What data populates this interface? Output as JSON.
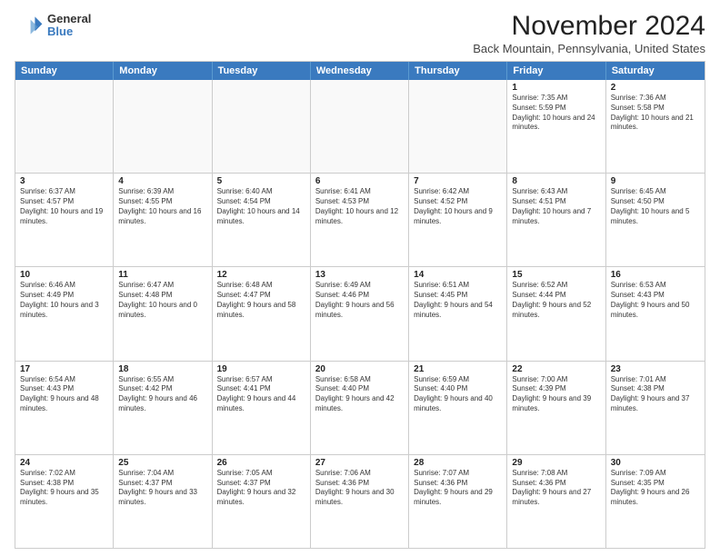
{
  "logo": {
    "general": "General",
    "blue": "Blue"
  },
  "title": "November 2024",
  "location": "Back Mountain, Pennsylvania, United States",
  "days_of_week": [
    "Sunday",
    "Monday",
    "Tuesday",
    "Wednesday",
    "Thursday",
    "Friday",
    "Saturday"
  ],
  "weeks": [
    [
      {
        "day": "",
        "info": ""
      },
      {
        "day": "",
        "info": ""
      },
      {
        "day": "",
        "info": ""
      },
      {
        "day": "",
        "info": ""
      },
      {
        "day": "",
        "info": ""
      },
      {
        "day": "1",
        "info": "Sunrise: 7:35 AM\nSunset: 5:59 PM\nDaylight: 10 hours and 24 minutes."
      },
      {
        "day": "2",
        "info": "Sunrise: 7:36 AM\nSunset: 5:58 PM\nDaylight: 10 hours and 21 minutes."
      }
    ],
    [
      {
        "day": "3",
        "info": "Sunrise: 6:37 AM\nSunset: 4:57 PM\nDaylight: 10 hours and 19 minutes."
      },
      {
        "day": "4",
        "info": "Sunrise: 6:39 AM\nSunset: 4:55 PM\nDaylight: 10 hours and 16 minutes."
      },
      {
        "day": "5",
        "info": "Sunrise: 6:40 AM\nSunset: 4:54 PM\nDaylight: 10 hours and 14 minutes."
      },
      {
        "day": "6",
        "info": "Sunrise: 6:41 AM\nSunset: 4:53 PM\nDaylight: 10 hours and 12 minutes."
      },
      {
        "day": "7",
        "info": "Sunrise: 6:42 AM\nSunset: 4:52 PM\nDaylight: 10 hours and 9 minutes."
      },
      {
        "day": "8",
        "info": "Sunrise: 6:43 AM\nSunset: 4:51 PM\nDaylight: 10 hours and 7 minutes."
      },
      {
        "day": "9",
        "info": "Sunrise: 6:45 AM\nSunset: 4:50 PM\nDaylight: 10 hours and 5 minutes."
      }
    ],
    [
      {
        "day": "10",
        "info": "Sunrise: 6:46 AM\nSunset: 4:49 PM\nDaylight: 10 hours and 3 minutes."
      },
      {
        "day": "11",
        "info": "Sunrise: 6:47 AM\nSunset: 4:48 PM\nDaylight: 10 hours and 0 minutes."
      },
      {
        "day": "12",
        "info": "Sunrise: 6:48 AM\nSunset: 4:47 PM\nDaylight: 9 hours and 58 minutes."
      },
      {
        "day": "13",
        "info": "Sunrise: 6:49 AM\nSunset: 4:46 PM\nDaylight: 9 hours and 56 minutes."
      },
      {
        "day": "14",
        "info": "Sunrise: 6:51 AM\nSunset: 4:45 PM\nDaylight: 9 hours and 54 minutes."
      },
      {
        "day": "15",
        "info": "Sunrise: 6:52 AM\nSunset: 4:44 PM\nDaylight: 9 hours and 52 minutes."
      },
      {
        "day": "16",
        "info": "Sunrise: 6:53 AM\nSunset: 4:43 PM\nDaylight: 9 hours and 50 minutes."
      }
    ],
    [
      {
        "day": "17",
        "info": "Sunrise: 6:54 AM\nSunset: 4:43 PM\nDaylight: 9 hours and 48 minutes."
      },
      {
        "day": "18",
        "info": "Sunrise: 6:55 AM\nSunset: 4:42 PM\nDaylight: 9 hours and 46 minutes."
      },
      {
        "day": "19",
        "info": "Sunrise: 6:57 AM\nSunset: 4:41 PM\nDaylight: 9 hours and 44 minutes."
      },
      {
        "day": "20",
        "info": "Sunrise: 6:58 AM\nSunset: 4:40 PM\nDaylight: 9 hours and 42 minutes."
      },
      {
        "day": "21",
        "info": "Sunrise: 6:59 AM\nSunset: 4:40 PM\nDaylight: 9 hours and 40 minutes."
      },
      {
        "day": "22",
        "info": "Sunrise: 7:00 AM\nSunset: 4:39 PM\nDaylight: 9 hours and 39 minutes."
      },
      {
        "day": "23",
        "info": "Sunrise: 7:01 AM\nSunset: 4:38 PM\nDaylight: 9 hours and 37 minutes."
      }
    ],
    [
      {
        "day": "24",
        "info": "Sunrise: 7:02 AM\nSunset: 4:38 PM\nDaylight: 9 hours and 35 minutes."
      },
      {
        "day": "25",
        "info": "Sunrise: 7:04 AM\nSunset: 4:37 PM\nDaylight: 9 hours and 33 minutes."
      },
      {
        "day": "26",
        "info": "Sunrise: 7:05 AM\nSunset: 4:37 PM\nDaylight: 9 hours and 32 minutes."
      },
      {
        "day": "27",
        "info": "Sunrise: 7:06 AM\nSunset: 4:36 PM\nDaylight: 9 hours and 30 minutes."
      },
      {
        "day": "28",
        "info": "Sunrise: 7:07 AM\nSunset: 4:36 PM\nDaylight: 9 hours and 29 minutes."
      },
      {
        "day": "29",
        "info": "Sunrise: 7:08 AM\nSunset: 4:36 PM\nDaylight: 9 hours and 27 minutes."
      },
      {
        "day": "30",
        "info": "Sunrise: 7:09 AM\nSunset: 4:35 PM\nDaylight: 9 hours and 26 minutes."
      }
    ]
  ]
}
